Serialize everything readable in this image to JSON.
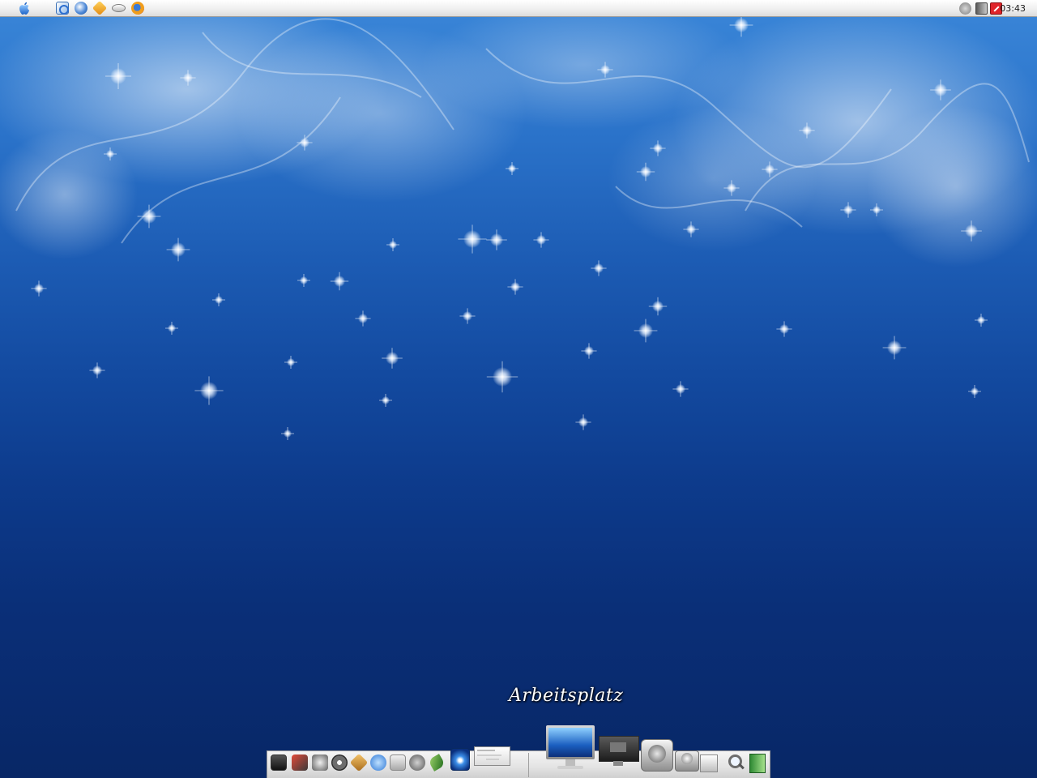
{
  "menubar": {
    "apple_menu_icon": "apple-icon",
    "quick_launch": [
      {
        "name": "outlook-express-icon"
      },
      {
        "name": "internet-explorer-icon"
      },
      {
        "name": "winamp-icon"
      },
      {
        "name": "drive-icon"
      },
      {
        "name": "firefox-icon"
      }
    ],
    "tray": [
      {
        "name": "network-icon"
      },
      {
        "name": "volume-icon"
      },
      {
        "name": "antivirus-icon"
      }
    ],
    "clock": "03:43"
  },
  "dock": {
    "hover_label": "Arbeitsplatz",
    "items": [
      {
        "name": "monitor-icon"
      },
      {
        "name": "media-player-icon"
      },
      {
        "name": "system-tools-icon"
      },
      {
        "name": "disc-drive-icon"
      },
      {
        "name": "packages-icon"
      },
      {
        "name": "sync-icon"
      },
      {
        "name": "hard-drive-icon"
      },
      {
        "name": "settings-dial-icon"
      },
      {
        "name": "leaf-icon"
      },
      {
        "name": "planet-icon"
      },
      {
        "name": "window-preview-icon"
      },
      {
        "name": "my-computer-icon"
      },
      {
        "name": "display-icon"
      },
      {
        "name": "hdd-icon"
      },
      {
        "name": "drive-globe-icon"
      },
      {
        "name": "stack-icon"
      },
      {
        "name": "search-icon"
      },
      {
        "name": "notes-icon"
      }
    ]
  },
  "colors": {
    "accent": "#2a72c9",
    "menubar": "#eeeeee",
    "tray_alert": "#e0252a"
  }
}
